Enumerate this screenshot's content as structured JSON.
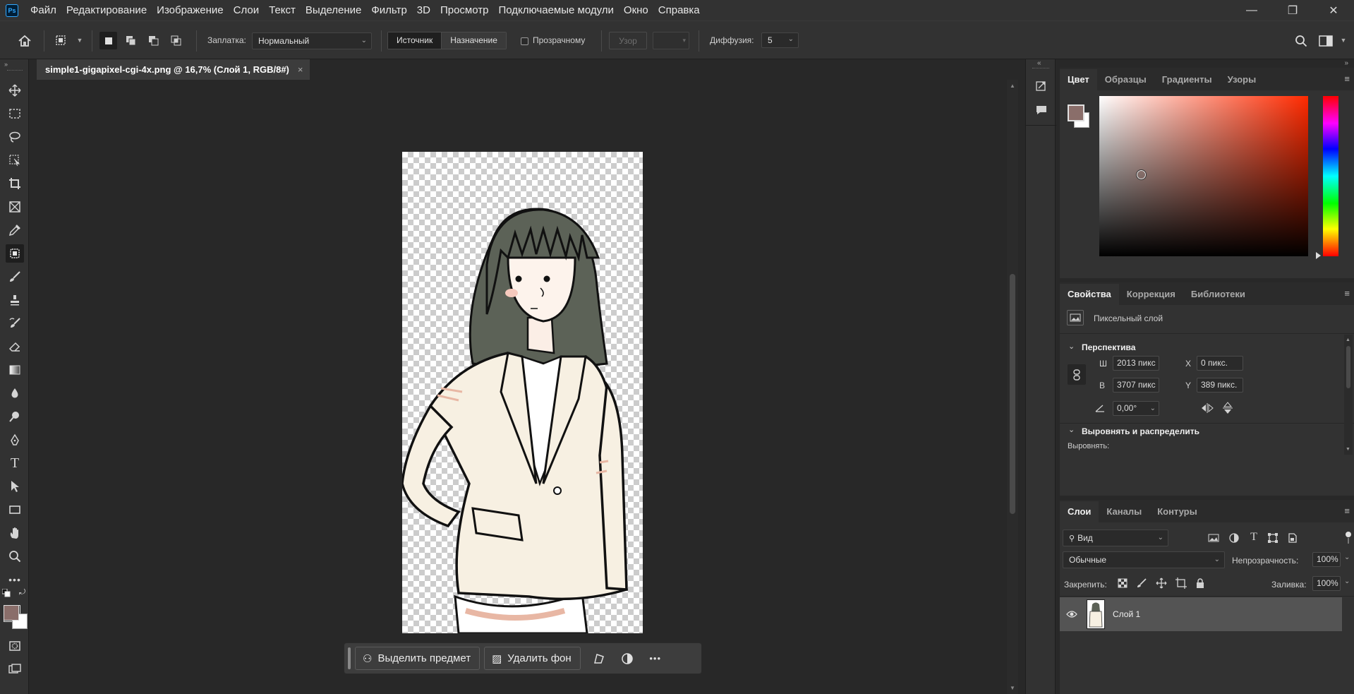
{
  "app": {
    "logo": "Ps"
  },
  "menu": [
    "Файл",
    "Редактирование",
    "Изображение",
    "Слои",
    "Текст",
    "Выделение",
    "Фильтр",
    "3D",
    "Просмотр",
    "Подключаемые модули",
    "Окно",
    "Справка"
  ],
  "window_controls": {
    "minimize": "—",
    "restore": "❐",
    "close": "✕"
  },
  "options": {
    "patch_label": "Заплатка:",
    "patch_mode": "Нормальный",
    "source": "Источник",
    "destination": "Назначение",
    "transparent": "Прозрачному",
    "pattern": "Узор",
    "diffusion_label": "Диффузия:",
    "diffusion_value": "5"
  },
  "document": {
    "tab_title": "simple1-gigapixel-cgi-4x.png @ 16,7% (Слой 1, RGB/8#)",
    "close": "×"
  },
  "taskbar": {
    "select_subject": "Выделить предмет",
    "remove_bg": "Удалить фон",
    "more": "•••"
  },
  "color_panel": {
    "tabs": [
      "Цвет",
      "Образцы",
      "Градиенты",
      "Узоры"
    ],
    "foreground": "#8a6e6a",
    "background": "#ffffff"
  },
  "properties": {
    "tabs": [
      "Свойства",
      "Коррекция",
      "Библиотеки"
    ],
    "layer_type": "Пиксельный слой",
    "perspective": "Перспектива",
    "w_label": "Ш",
    "w": "2013 пикс",
    "h_label": "В",
    "h": "3707 пикс",
    "x_label": "X",
    "x": "0 пикс.",
    "y_label": "Y",
    "y": "389 пикс.",
    "angle": "0,00°",
    "align_section": "Выровнять и распределить",
    "align_label": "Выровнять:"
  },
  "layers": {
    "tabs": [
      "Слои",
      "Каналы",
      "Контуры"
    ],
    "filter": "Вид",
    "blend_mode": "Обычные",
    "opacity_label": "Непрозрачность:",
    "opacity": "100%",
    "lock_label": "Закрепить:",
    "fill_label": "Заливка:",
    "fill": "100%",
    "items": [
      {
        "name": "Слой 1"
      }
    ]
  }
}
